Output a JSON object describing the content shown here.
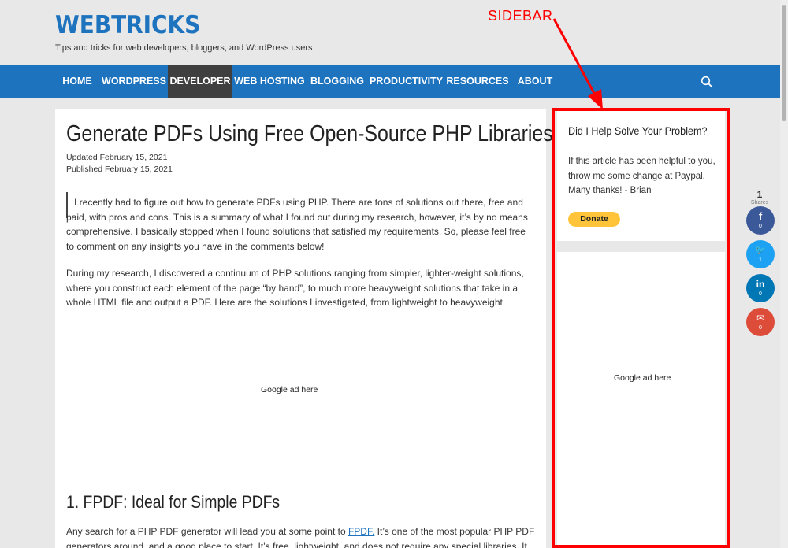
{
  "header": {
    "site_title": "WEBTRICKS",
    "tagline": "Tips and tricks for web developers, bloggers, and WordPress users",
    "annotation": "SIDEBAR"
  },
  "nav": {
    "items": [
      {
        "label": "HOME"
      },
      {
        "label": "WORDPRESS"
      },
      {
        "label": "DEVELOPER",
        "active": true
      },
      {
        "label": "WEB HOSTING"
      },
      {
        "label": "BLOGGING"
      },
      {
        "label": "PRODUCTIVITY"
      },
      {
        "label": "RESOURCES"
      },
      {
        "label": "ABOUT"
      }
    ],
    "search_icon": "search-icon"
  },
  "article": {
    "title": "Generate PDFs Using Free Open-Source PHP Libraries",
    "updated": "Updated February 15, 2021",
    "published": "Published February 15, 2021",
    "para1": "I recently had to figure out how to generate PDFs using PHP. There are tons of solutions out there, free and paid, with pros and cons. This is a summary of what I found out during my research, however, it’s by no means comprehensive. I basically stopped when I found solutions that satisfied my requirements. So, please feel free to comment on any insights you have in the comments below!",
    "para2": "During my research, I discovered a continuum of PHP solutions ranging from simpler, lighter-weight solutions, where you construct each element of the page “by hand”, to much more heavyweight solutions that take in a whole HTML file and output a PDF. Here are the solutions I investigated, from lightweight to heavyweight.",
    "ad_text": "Google ad here",
    "section_title": "1. FPDF: Ideal for Simple PDFs",
    "para3_before": "Any search for a PHP PDF generator will lead you at some point to ",
    "para3_link": "FPDF.",
    "para3_after": " It’s one of the most popular PHP PDF generators around, and a good place to start. It’s free, lightweight, and does not require any special libraries. It"
  },
  "sidebar": {
    "widget_title": "Did I Help Solve Your Problem?",
    "widget_text": "If this article has been helpful to you, throw me some change at Paypal. Many thanks! - Brian",
    "donate_label": "Donate",
    "ad_text": "Google ad here"
  },
  "share": {
    "total": "1",
    "label": "Shares",
    "buttons": [
      {
        "name": "facebook",
        "icon": "f",
        "count": "0",
        "color": "#3b5998"
      },
      {
        "name": "twitter",
        "icon": "🐦",
        "count": "1",
        "color": "#1da1f2"
      },
      {
        "name": "linkedin",
        "icon": "in",
        "count": "0",
        "color": "#0077b5"
      },
      {
        "name": "email",
        "icon": "✉",
        "count": "0",
        "color": "#dd4b39"
      }
    ]
  },
  "colors": {
    "brand_blue": "#1e73be",
    "nav_active": "#3f3f3f",
    "annotation_red": "#ff0000",
    "paypal_yellow": "#ffc439"
  }
}
